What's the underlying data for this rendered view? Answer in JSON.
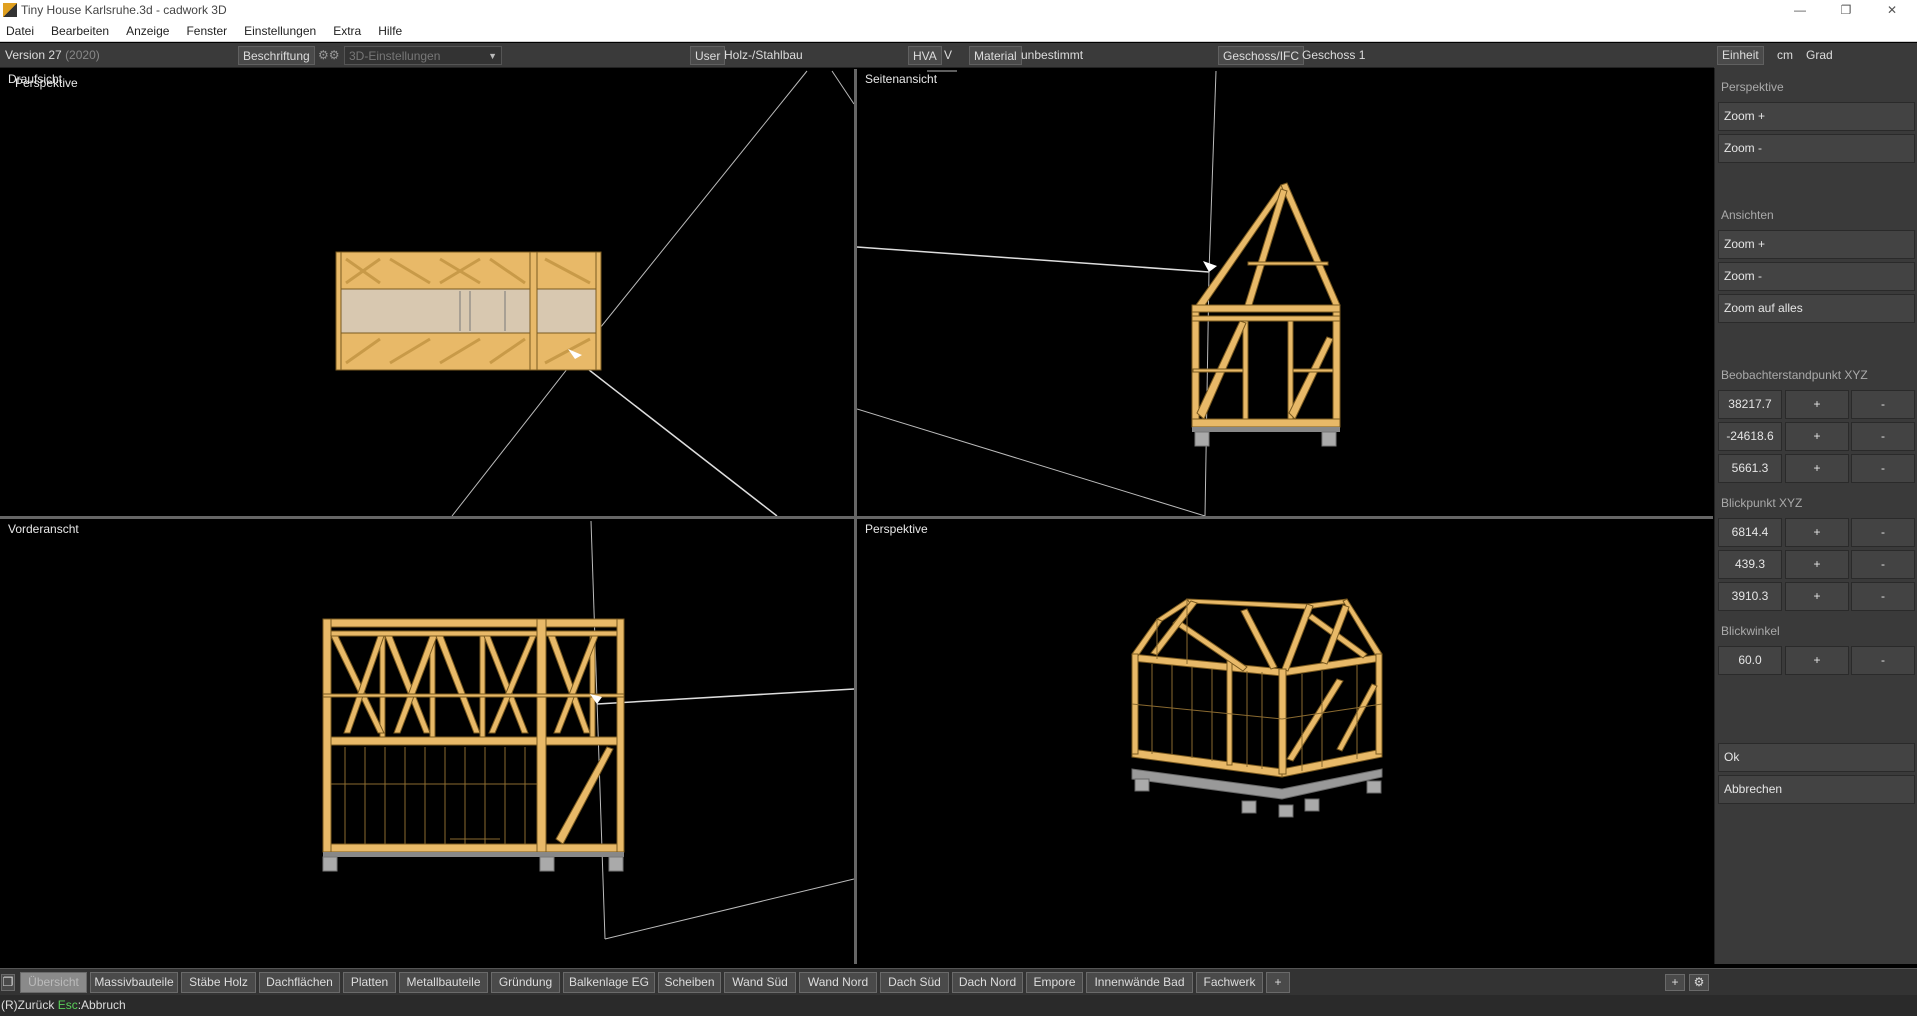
{
  "window": {
    "title": "Tiny House Karlsruhe.3d - cadwork 3D"
  },
  "menu": [
    "Datei",
    "Bearbeiten",
    "Anzeige",
    "Fenster",
    "Einstellungen",
    "Extra",
    "Hilfe"
  ],
  "toolbar": {
    "version": "Version 27",
    "version_year": "(2020)",
    "beschriftung": "Beschriftung",
    "settings_dropdown": "3D-Einstellungen",
    "user_btn": "User",
    "user_value": "Holz-/Stahlbau",
    "hva_btn": "HVA",
    "hva_value": "V",
    "material_btn": "Material",
    "material_value": "unbestimmt",
    "geschoss_btn": "Geschoss/IFC",
    "geschoss_value": "Geschoss 1"
  },
  "units": {
    "einheit": "Einheit",
    "cm": "cm",
    "grad": "Grad"
  },
  "viewports": {
    "top_left_label": "Draufsicht",
    "top_left_overlay": "Perspektive",
    "top_right_label": "Seitenansicht",
    "bottom_left_label": "Vorderanscht",
    "bottom_right_label": "Perspektive"
  },
  "panel": {
    "perspektive": "Perspektive",
    "zoom_plus_1": "Zoom +",
    "zoom_minus_1": "Zoom -",
    "ansichten": "Ansichten",
    "zoom_plus_2": "Zoom +",
    "zoom_minus_2": "Zoom -",
    "zoom_all": "Zoom auf alles",
    "beobachter": "Beobachterstandpunkt XYZ",
    "beobachter_values": [
      "38217.7",
      "-24618.6",
      "5661.3"
    ],
    "blickpunkt": "Blickpunkt XYZ",
    "blickpunkt_values": [
      "6814.4",
      "439.3",
      "3910.3"
    ],
    "blickwinkel": "Blickwinkel",
    "blickwinkel_value": "60.0",
    "plus": "+",
    "minus": "-",
    "ok": "Ok",
    "abbrechen": "Abbrechen"
  },
  "tabs": [
    "Übersicht",
    "Massivbauteile",
    "Stäbe Holz",
    "Dachflächen",
    "Platten",
    "Metallbauteile",
    "Gründung",
    "Balkenlage EG",
    "Scheiben",
    "Wand Süd",
    "Wand Nord",
    "Dach Süd",
    "Dach Nord",
    "Empore",
    "Innenwände Bad",
    "Fachwerk",
    "+"
  ],
  "tabbar_right": {
    "plus": "+"
  },
  "status": {
    "back": "(R)Zurück",
    "esc_key": "Esc",
    "esc_text": ":Abbruch"
  },
  "colors": {
    "timber": "#e8b968",
    "timber_edge": "#7a5a20",
    "panel_bg": "#3a3a3a"
  }
}
